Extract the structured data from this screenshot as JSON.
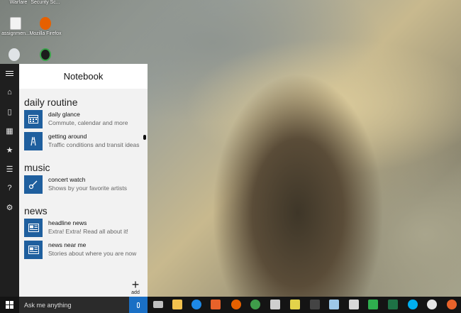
{
  "desktop": {
    "icons": [
      {
        "label": "Warfare",
        "icon": "game-icon",
        "color": "#6b6b6b"
      },
      {
        "label": "Security Sc...",
        "icon": "security-icon",
        "color": "#4a4a4a"
      },
      {
        "label": "assignmen...",
        "icon": "document-icon",
        "color": "#f2f2f2"
      },
      {
        "label": "Mozilla Firefox",
        "icon": "firefox-icon",
        "color": "#e66000"
      },
      {
        "label": "",
        "icon": "user-icon",
        "color": "#dfe3e6"
      },
      {
        "label": "",
        "icon": "refresh-icon",
        "color": "#3aa34a"
      }
    ]
  },
  "rail": {
    "items": [
      {
        "icon": "hamburger-icon"
      },
      {
        "icon": "home-icon",
        "glyph": "⌂"
      },
      {
        "icon": "notebook-icon",
        "glyph": "▯"
      },
      {
        "icon": "calendar-icon",
        "glyph": "▦"
      },
      {
        "icon": "star-icon",
        "glyph": "★"
      },
      {
        "icon": "news-icon",
        "glyph": "☰"
      },
      {
        "icon": "help-icon",
        "glyph": "?"
      },
      {
        "icon": "settings-icon",
        "glyph": "⚙"
      }
    ]
  },
  "notebook": {
    "title": "Notebook",
    "sections": [
      {
        "title": "daily routine",
        "items": [
          {
            "title": "daily glance",
            "subtitle": "Commute, calendar and more",
            "icon": "daily-glance-icon"
          },
          {
            "title": "getting around",
            "subtitle": "Traffic conditions and transit ideas",
            "icon": "road-icon"
          }
        ]
      },
      {
        "title": "music",
        "items": [
          {
            "title": "concert watch",
            "subtitle": "Shows by your favorite artists",
            "icon": "guitar-icon"
          }
        ]
      },
      {
        "title": "news",
        "items": [
          {
            "title": "headline news",
            "subtitle": "Extra! Extra! Read all about it!",
            "icon": "newspaper-icon"
          },
          {
            "title": "news near me",
            "subtitle": "Stories about where you are now",
            "icon": "newspaper-icon"
          }
        ]
      }
    ],
    "add_label": "add",
    "add_glyph": "+"
  },
  "taskbar": {
    "search_placeholder": "Ask me anything",
    "apps": [
      {
        "icon": "task-view-icon",
        "color": "#bfbfbf"
      },
      {
        "icon": "file-explorer-icon",
        "color": "#f2c14e"
      },
      {
        "icon": "edge-icon",
        "color": "#1e88e5"
      },
      {
        "icon": "media-player-icon",
        "color": "#e8622a"
      },
      {
        "icon": "firefox-icon",
        "color": "#e66000"
      },
      {
        "icon": "chrome-icon",
        "color": "#3f9c4a"
      },
      {
        "icon": "printer-icon",
        "color": "#cfcfcf"
      },
      {
        "icon": "sticky-notes-icon",
        "color": "#e3d34a"
      },
      {
        "icon": "terminal-icon",
        "color": "#444444"
      },
      {
        "icon": "app-icon",
        "color": "#9ec8e8"
      },
      {
        "icon": "monitor-icon",
        "color": "#d8d8d8"
      },
      {
        "icon": "green-app-icon",
        "color": "#2fae4e"
      },
      {
        "icon": "excel-icon",
        "color": "#1e7145"
      },
      {
        "icon": "skype-icon",
        "color": "#00aff0"
      },
      {
        "icon": "opera-icon",
        "color": "#e6e6e6"
      },
      {
        "icon": "settings-app-icon",
        "color": "#e8622a"
      }
    ]
  }
}
